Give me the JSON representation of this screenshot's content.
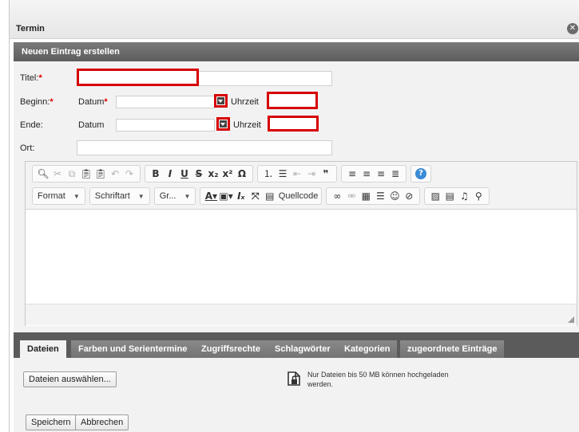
{
  "dialog": {
    "title": "Termin",
    "close_icon": "close-icon"
  },
  "section": {
    "title": "Neuen Eintrag erstellen"
  },
  "form": {
    "title_label": "Titel:",
    "required_mark": "*",
    "title_value": "",
    "begin_label": "Beginn:",
    "begin_date_label": "Datum",
    "begin_date_value": "",
    "begin_time_label": "Uhrzeit",
    "begin_time_value": "",
    "end_label": "Ende:",
    "end_date_label": "Datum",
    "end_date_value": "",
    "end_time_label": "Uhrzeit",
    "end_time_value": "",
    "location_label": "Ort:",
    "location_value": ""
  },
  "editor": {
    "format_label": "Format",
    "font_label": "Schriftart",
    "size_label": "Gr...",
    "source_label": "Quellcode",
    "content": ""
  },
  "tabs": [
    {
      "label": "Dateien",
      "active": true
    },
    {
      "label": "Farben und Serientermine"
    },
    {
      "label": "Zugriffsrechte"
    },
    {
      "label": "Schlagwörter"
    },
    {
      "label": "Kategorien"
    },
    {
      "label": "zugeordnete Einträge"
    }
  ],
  "files": {
    "choose_button": "Dateien auswählen...",
    "note": "Nur Dateien bis 50 MB können hochgeladen werden."
  },
  "footer": {
    "save_button": "Speichern",
    "cancel_button": "Abbrechen"
  },
  "colors": {
    "highlight": "#d60000",
    "header": "#666666",
    "panel": "#f2f2f2"
  }
}
